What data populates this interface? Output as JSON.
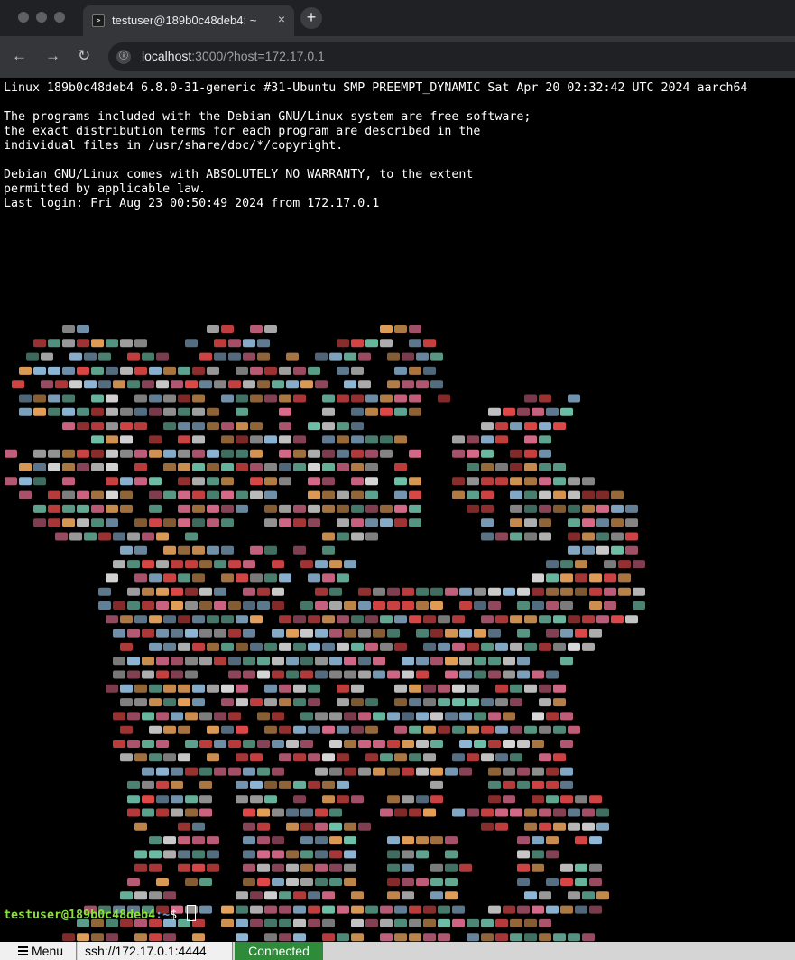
{
  "browser": {
    "tab_title": "testuser@189b0c48deb4: ~",
    "tab_close": "×",
    "new_tab": "+",
    "back": "←",
    "forward": "→",
    "reload": "↻",
    "url_host": "localhost",
    "url_rest": ":3000/?host=172.17.0.1"
  },
  "terminal": {
    "lines": [
      "Linux 189b0c48deb4 6.8.0-31-generic #31-Ubuntu SMP PREEMPT_DYNAMIC Sat Apr 20 02:32:42 UTC 2024 aarch64",
      "",
      "The programs included with the Debian GNU/Linux system are free software;",
      "the exact distribution terms for each program are described in the",
      "individual files in /usr/share/doc/*/copyright.",
      "",
      "Debian GNU/Linux comes with ABSOLUTELY NO WARRANTY, to the extent",
      "permitted by applicable law.",
      "Last login: Fri Aug 23 00:50:49 2024 from 172.17.0.1"
    ],
    "prompt_user": "testuser@189b0c48deb4",
    "prompt_path": ":~",
    "prompt_symbol": "$"
  },
  "status_bar": {
    "menu_label": "Menu",
    "ssh_label": "ssh://172.17.0.1:4444",
    "connection_status": "Connected"
  },
  "colors": {
    "prompt_user": "#8ae234",
    "connected": "#2e8b3a",
    "art_palette": [
      "#e6a15a",
      "#d96a8a",
      "#8fb8d8",
      "#d8d8d8",
      "#e04848",
      "#6fc0a8"
    ]
  }
}
